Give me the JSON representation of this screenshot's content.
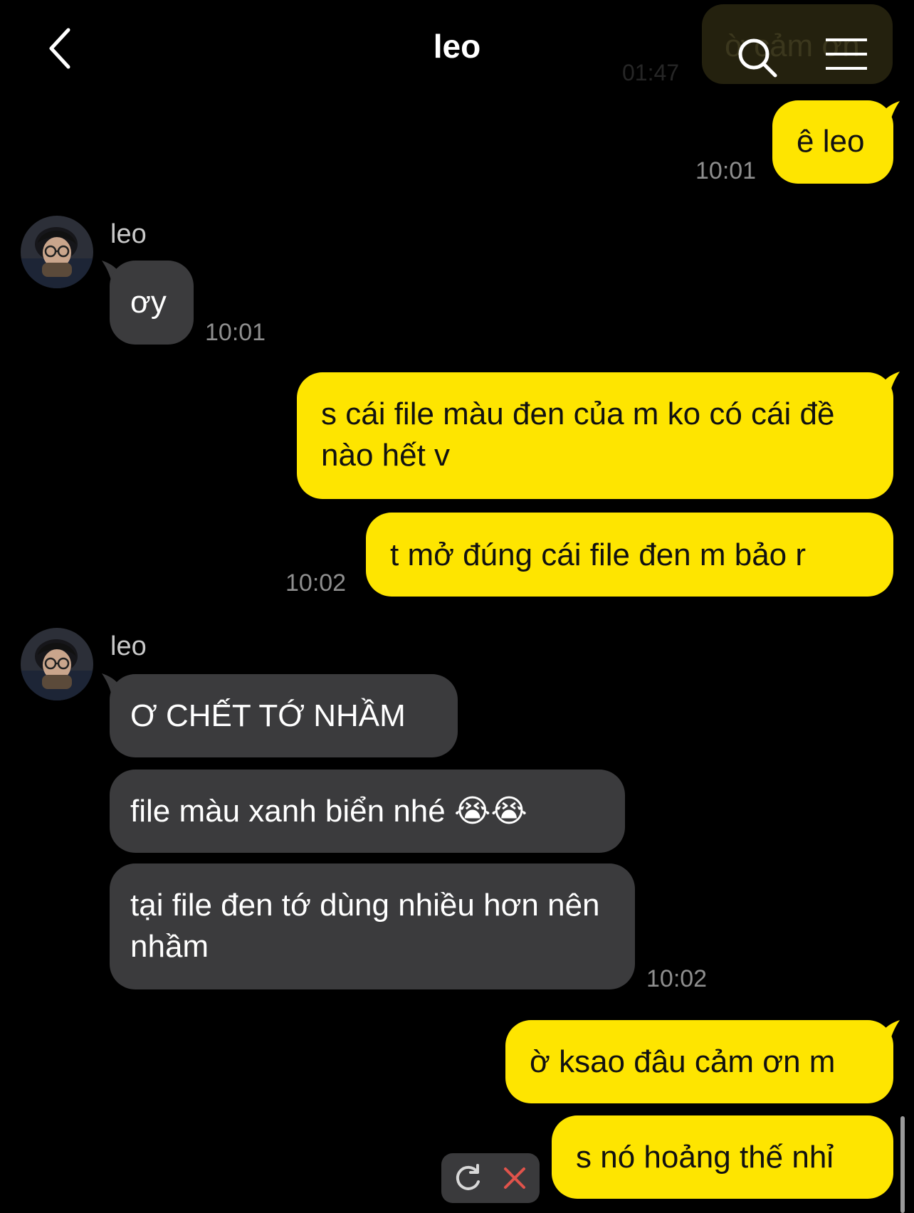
{
  "header": {
    "title": "leo",
    "back_icon": "chevron-left-icon",
    "search_icon": "search-icon",
    "menu_icon": "hamburger-menu-icon"
  },
  "colors": {
    "background": "#000000",
    "outgoing_bubble": "#fee500",
    "incoming_bubble": "#3b3b3d",
    "timestamp": "#8e8e8e"
  },
  "chat": {
    "ghost_preview": {
      "text": "ờ cảm ơn",
      "time": "01:47"
    },
    "messages": [
      {
        "dir": "out",
        "text": "ê leo",
        "time": "10:01"
      },
      {
        "dir": "in",
        "sender": "leo",
        "text": "ơy",
        "time": "10:01"
      },
      {
        "dir": "out",
        "text": "s cái file màu đen của m ko có cái đề nào hết v"
      },
      {
        "dir": "out",
        "text": "t mở đúng cái file đen m bảo r",
        "time": "10:02"
      },
      {
        "dir": "in",
        "sender": "leo",
        "text": "Ơ CHẾT TỚ NHẦM"
      },
      {
        "dir": "in",
        "text": "file màu xanh biển nhé 😭😭"
      },
      {
        "dir": "in",
        "text": "tại file đen tớ dùng nhiều hơn nên nhầm",
        "time": "10:02"
      },
      {
        "dir": "out",
        "text": "ờ ksao đâu cảm ơn m"
      },
      {
        "dir": "out",
        "text": "s nó hoảng thế nhỉ"
      }
    ]
  },
  "send_status": {
    "retry_icon": "retry-icon",
    "delete_icon": "close-icon"
  }
}
